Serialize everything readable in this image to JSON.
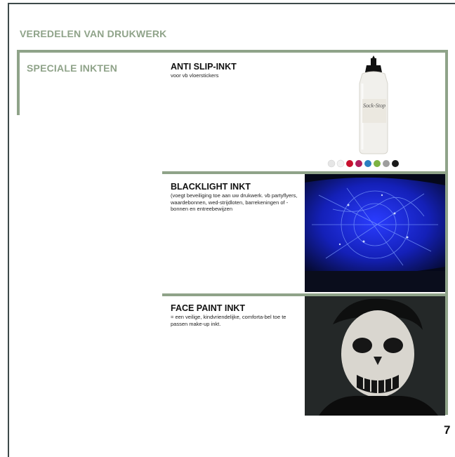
{
  "section": {
    "title": "VEREDELEN VAN DRUKWERK"
  },
  "category": {
    "title": "SPECIALE INKTEN"
  },
  "products": [
    {
      "name": "ANTI SLIP-INKT",
      "description": "voor vb vloerstickers"
    },
    {
      "name": "BLACKLIGHT INKT",
      "description": "(voegt beveiliging toe aan uw drukwerk. vb partyflyers, waardebonnen, wed-strijdloten, barrekeningen of -bonnen en entreebewijzen"
    },
    {
      "name": "FACE PAINT INKT",
      "description": "= een veilige, kindvriendelijke, comforta-bel toe te passen make-up inkt."
    }
  ],
  "bottle": {
    "brand_label": "Sock-Stop"
  },
  "page": {
    "number": "7"
  },
  "colors": {
    "accent": "#8fa389",
    "frame": "#3d4a4a",
    "text": "#111111",
    "swatches": [
      "#e6e6e6",
      "#f2f2f2",
      "#c8102e",
      "#b01e5b",
      "#2a7fc1",
      "#7cb342",
      "#9e9e9e",
      "#1a1a1a"
    ]
  }
}
